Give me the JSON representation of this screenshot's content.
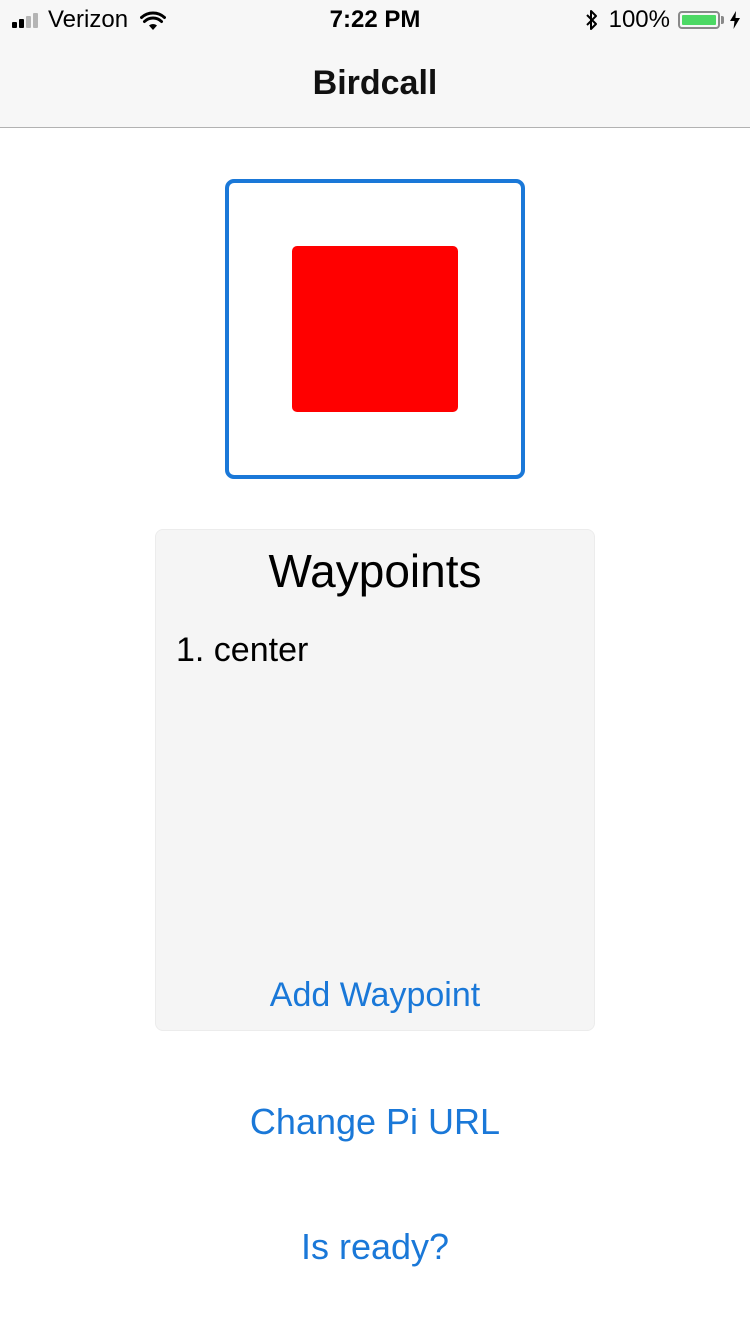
{
  "status_bar": {
    "carrier": "Verizon",
    "time": "7:22 PM",
    "battery_percent": "100%",
    "battery_level": 1.0,
    "signal_bars_filled": 2,
    "signal_bars_total": 4,
    "icons": [
      "signal-icon",
      "wifi-icon",
      "bluetooth-icon",
      "battery-icon",
      "charging-icon"
    ]
  },
  "nav": {
    "title": "Birdcall"
  },
  "stop_button": {
    "icon": "stop-icon",
    "border_color": "#1a78d8",
    "icon_color": "#ff0000"
  },
  "waypoints": {
    "title": "Waypoints",
    "items": [
      {
        "label": "1. center"
      }
    ],
    "add_label": "Add Waypoint"
  },
  "actions": {
    "change_url_label": "Change Pi URL",
    "is_ready_label": "Is ready?"
  },
  "colors": {
    "accent": "#1a78d8",
    "stop": "#ff0000",
    "battery": "#4cd964"
  }
}
